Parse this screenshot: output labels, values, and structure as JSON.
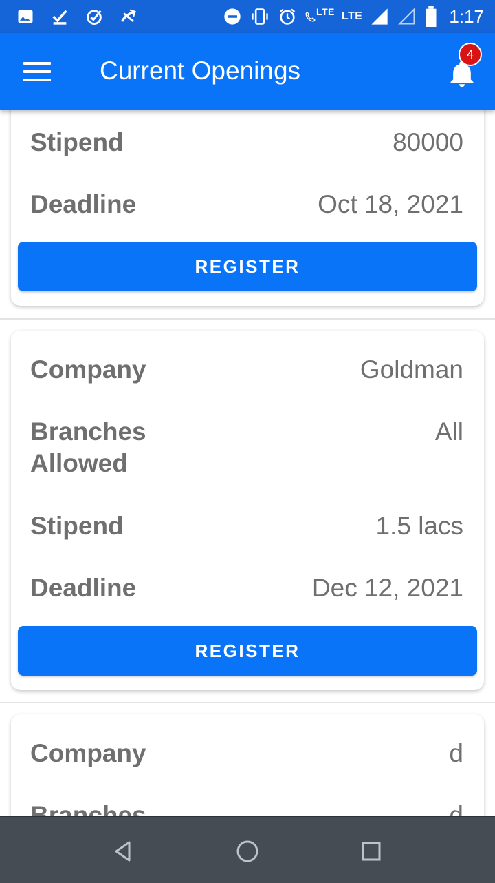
{
  "status_bar": {
    "time": "1:17",
    "lte1": "LTE",
    "lte2": "LTE",
    "icons": [
      "gallery-icon",
      "check-icon",
      "check-circle-icon",
      "missed-call-icon",
      "dnd-icon",
      "vibrate-icon",
      "alarm-icon",
      "call-lte-icon",
      "signal-icon",
      "signal-empty-icon",
      "battery-icon"
    ]
  },
  "appbar": {
    "title": "Current Openings",
    "notification_count": "4"
  },
  "cards": [
    {
      "fields": [
        {
          "label": "Stipend",
          "value": "80000"
        },
        {
          "label": "Deadline",
          "value": "Oct 18, 2021"
        }
      ],
      "button": "REGISTER"
    },
    {
      "fields": [
        {
          "label": "Company",
          "value": "Goldman"
        },
        {
          "label": "Branches Allowed",
          "value": "All"
        },
        {
          "label": "Stipend",
          "value": "1.5 lacs"
        },
        {
          "label": "Deadline",
          "value": "Dec 12, 2021"
        }
      ],
      "button": "REGISTER"
    },
    {
      "fields": [
        {
          "label": "Company",
          "value": "d"
        },
        {
          "label": "Branches",
          "value": "d"
        }
      ]
    }
  ],
  "colors": {
    "accent": "#0a74f8",
    "status_bar": "#1565d8",
    "badge": "#d81313",
    "text": "#6f6f6f",
    "nav_bar": "#464c53"
  }
}
